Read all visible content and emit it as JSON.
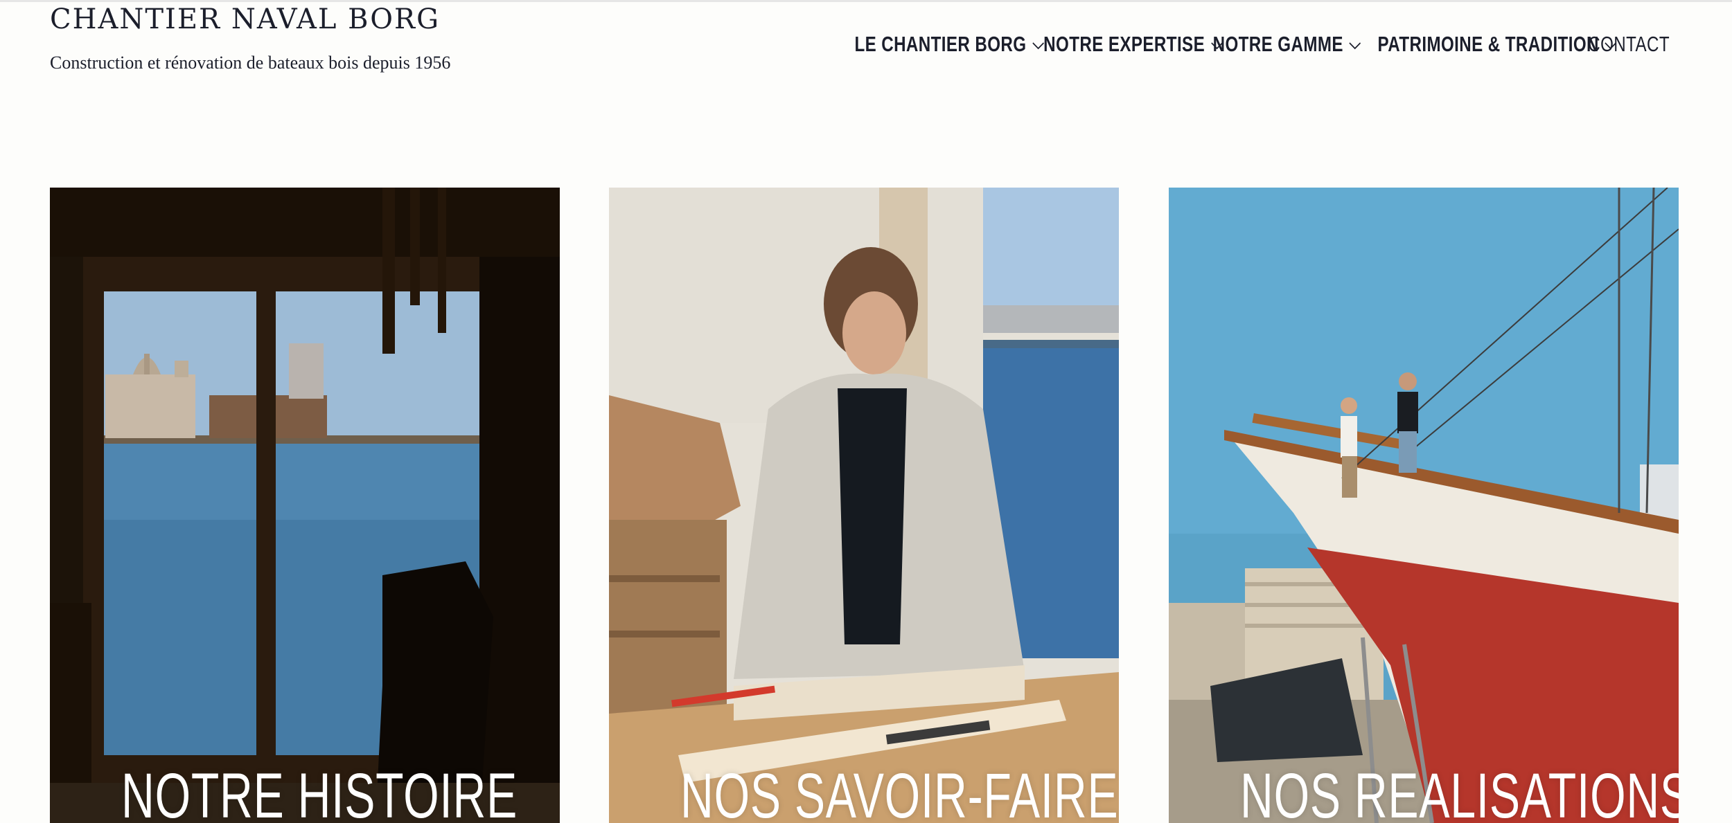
{
  "brand": {
    "title": "CHANTIER NAVAL BORG",
    "tagline": "Construction et rénovation de bateaux bois depuis 1956"
  },
  "nav": {
    "items": [
      {
        "label": "LE CHANTIER BORG",
        "has_dropdown": true
      },
      {
        "label": "NOTRE EXPERTISE",
        "has_dropdown": true
      },
      {
        "label": "NOTRE GAMME",
        "has_dropdown": true
      },
      {
        "label": "PATRIMOINE & TRADITION",
        "has_dropdown": true
      },
      {
        "label": "CONTACT",
        "has_dropdown": false
      }
    ],
    "chevron_icon": "chevron-down-icon"
  },
  "cards": [
    {
      "label": "NOTRE HISTOIRE",
      "image": "workshop-window-harbor-photo"
    },
    {
      "label": "NOS SAVOIR-FAIRE",
      "image": "craftsman-planing-wood-photo"
    },
    {
      "label": "NOS REALISATIONS",
      "image": "sailboat-on-drydock-photo"
    }
  ],
  "colors": {
    "text": "#1b1e2b",
    "background": "#fdfdfb",
    "card_label": "#ffffff"
  }
}
